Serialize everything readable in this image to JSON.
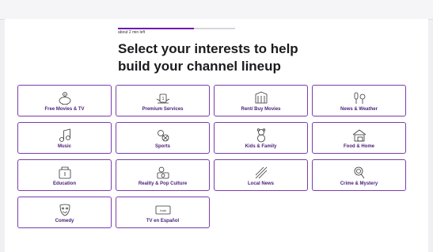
{
  "progress": {
    "text": "about 2 min left",
    "fraction": 0.65
  },
  "title": "Select your interests to help build your channel lineup",
  "accent_color": "#6f1ab1",
  "categories": [
    {
      "label": "Free Movies & TV",
      "icon": "piggy-bank-icon"
    },
    {
      "label": "Premium Services",
      "icon": "premium-badge-icon"
    },
    {
      "label": "Rent/ Buy Movies",
      "icon": "theater-icon"
    },
    {
      "label": "News & Weather",
      "icon": "microphone-weather-icon"
    },
    {
      "label": "Music",
      "icon": "music-notes-icon"
    },
    {
      "label": "Sports",
      "icon": "sports-balls-icon"
    },
    {
      "label": "Kids & Family",
      "icon": "teddy-bear-icon"
    },
    {
      "label": "Food & Home",
      "icon": "house-icon"
    },
    {
      "label": "Education",
      "icon": "books-icon"
    },
    {
      "label": "Reality & Pop Culture",
      "icon": "camera-icon"
    },
    {
      "label": "Local News",
      "icon": "local-news-icon"
    },
    {
      "label": "Crime & Mystery",
      "icon": "magnifier-icon"
    },
    {
      "label": "Comedy",
      "icon": "comedy-mask-icon"
    },
    {
      "label": "TV en Español",
      "icon": "hola-sign-icon",
      "icon_text": "hola"
    }
  ]
}
